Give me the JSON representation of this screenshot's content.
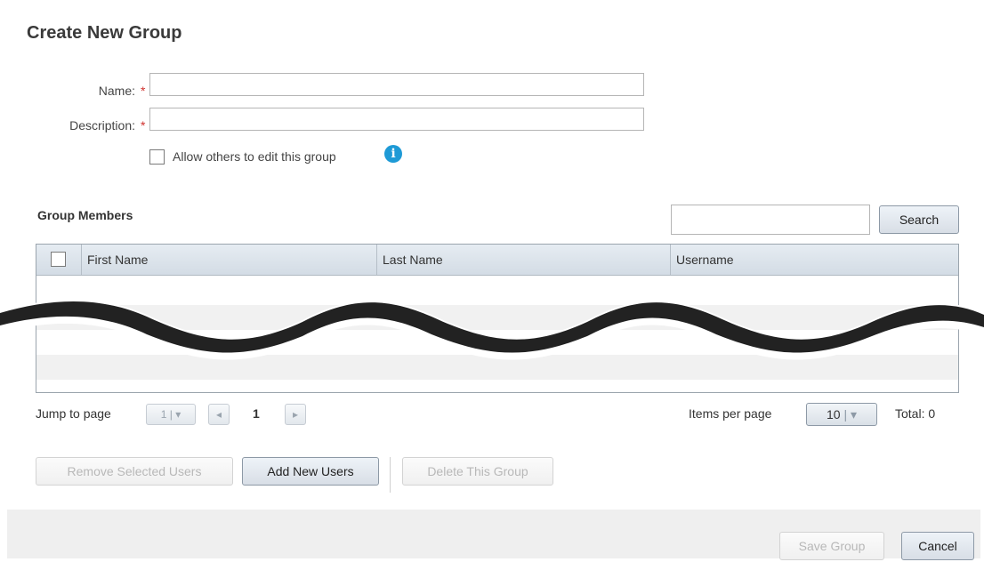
{
  "dialog": {
    "title": "Create New Group"
  },
  "form": {
    "name_label": "Name:",
    "name_value": "",
    "description_label": "Description:",
    "description_value": "",
    "required_marker": "*",
    "allow_edit_label": "Allow others to edit this group",
    "allow_edit_checked": false,
    "info_icon": "i"
  },
  "members": {
    "section_title": "Group Members",
    "search_value": "",
    "search_button": "Search",
    "columns": [
      "First Name",
      "Last Name",
      "Username"
    ]
  },
  "pager": {
    "jump_label": "Jump to page",
    "jump_value": "1",
    "current_page": "1",
    "items_per_page_label": "Items per page",
    "items_per_page_value": "10",
    "total_label": "Total: 0"
  },
  "actions": {
    "remove_selected": "Remove Selected Users",
    "add_new": "Add New Users",
    "delete_group": "Delete This Group"
  },
  "footer": {
    "save": "Save Group",
    "cancel": "Cancel"
  },
  "colors": {
    "info": "#1e9ad6",
    "required": "#d0312d",
    "grid_header": "#dfe6ed"
  }
}
